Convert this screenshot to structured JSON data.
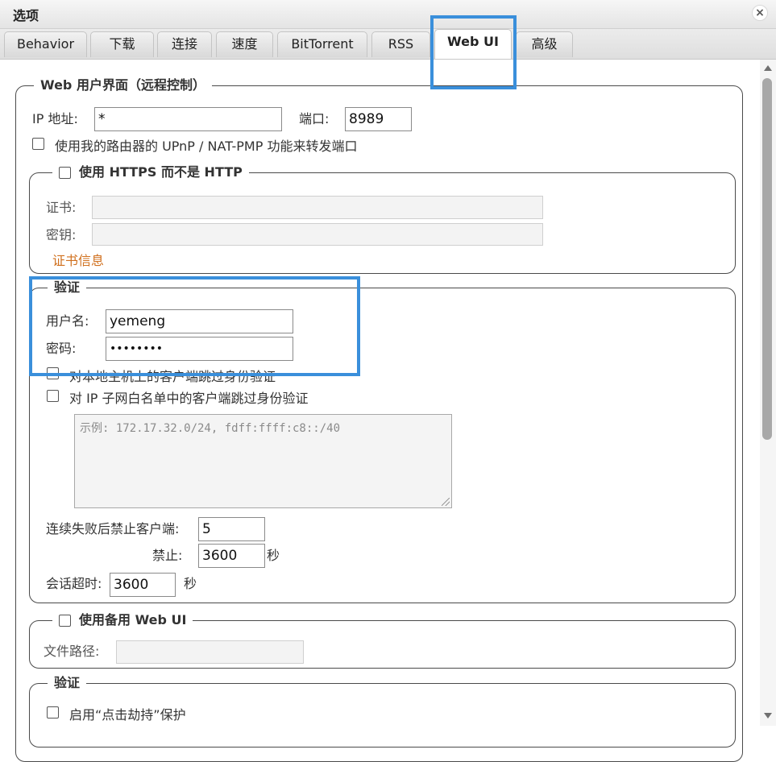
{
  "window": {
    "title": "选项",
    "close_glyph": "×"
  },
  "tabs": [
    {
      "label": "Behavior"
    },
    {
      "label": "下载"
    },
    {
      "label": "连接"
    },
    {
      "label": "速度"
    },
    {
      "label": "BitTorrent"
    },
    {
      "label": "RSS"
    },
    {
      "label": "Web UI",
      "active": true
    },
    {
      "label": "高级"
    }
  ],
  "webui": {
    "legend": "Web 用户界面（远程控制）",
    "ip_label": "IP 地址:",
    "ip_value": "*",
    "port_label": "端口:",
    "port_value": "8989",
    "upnp_label": "使用我的路由器的 UPnP / NAT-PMP 功能来转发端口"
  },
  "https": {
    "legend": "使用 HTTPS 而不是 HTTP",
    "cert_label": "证书:",
    "key_label": "密钥:",
    "cert_info_link": "证书信息"
  },
  "auth": {
    "legend": "验证",
    "username_label": "用户名:",
    "username_value": "yemeng",
    "password_label": "密码:",
    "password_value": "••••••••",
    "bypass_local_label": "对本地主机上的客户端跳过身份验证",
    "bypass_whitelist_label": "对 IP 子网白名单中的客户端跳过身份验证",
    "whitelist_placeholder": "示例: 172.17.32.0/24, fdff:ffff:c8::/40",
    "ban_after_label": "连续失败后禁止客户端:",
    "ban_after_value": "5",
    "ban_label": "禁止:",
    "ban_value": "3600",
    "ban_unit": "秒",
    "session_timeout_label": "会话超时:",
    "session_timeout_value": "3600",
    "session_timeout_unit": "秒"
  },
  "alt_webui": {
    "legend": "使用备用 Web UI",
    "path_label": "文件路径:"
  },
  "security": {
    "legend": "验证",
    "clickjacking_label": "启用“点击劫持”保护"
  },
  "colors": {
    "highlight": "#3a8fdb",
    "link": "#d0701e"
  }
}
